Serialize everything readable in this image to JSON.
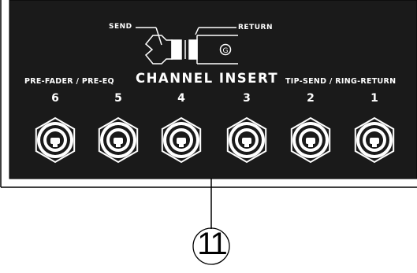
{
  "labels": {
    "send": "SEND",
    "return": "RETURN",
    "left_section": "PRE-FADER / PRE-EQ",
    "title": "CHANNEL INSERT",
    "right_section": "TIP-SEND / RING-RETURN"
  },
  "ground_symbol": "G",
  "channels": [
    "6",
    "5",
    "4",
    "3",
    "2",
    "1"
  ],
  "callout": "11",
  "colors": {
    "panel": "#1a1a1a",
    "text": "#ffffff",
    "outline": "#000000",
    "background": "#ffffff"
  }
}
